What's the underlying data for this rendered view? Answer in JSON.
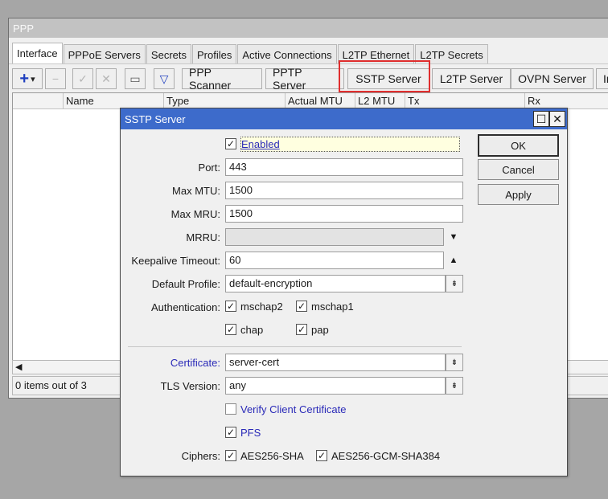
{
  "ppp": {
    "title": "PPP",
    "tabs": [
      "Interface",
      "PPPoE Servers",
      "Secrets",
      "Profiles",
      "Active Connections",
      "L2TP Ethernet",
      "L2TP Secrets"
    ],
    "toolbar": {
      "add_glyph": "+",
      "add_arrow": "▾",
      "remove_glyph": "−",
      "enable_glyph": "✓",
      "disable_glyph": "✕",
      "comment_glyph": "▭",
      "filter_glyph": "▽",
      "buttons": [
        "PPP Scanner",
        "PPTP Server",
        "SSTP Server",
        "L2TP Server",
        "OVPN Server",
        "In"
      ]
    },
    "columns": [
      "Name",
      "Type",
      "Actual MTU",
      "L2 MTU",
      "Tx",
      "Rx"
    ],
    "scroll_left": "◀",
    "status": "0 items out of 3"
  },
  "dlg": {
    "title": "SSTP Server",
    "maximize_glyph": "☐",
    "close_glyph": "✕",
    "enabled_label": "Enabled",
    "port_label": "Port:",
    "port": "443",
    "max_mtu_label": "Max MTU:",
    "max_mtu": "1500",
    "max_mru_label": "Max MRU:",
    "max_mru": "1500",
    "mrru_label": "MRRU:",
    "mrru": "",
    "keepalive_label": "Keepalive Timeout:",
    "keepalive": "60",
    "default_profile_label": "Default Profile:",
    "default_profile": "default-encryption",
    "auth_label": "Authentication:",
    "auth": [
      "mschap2",
      "mschap1",
      "chap",
      "pap"
    ],
    "certificate_label": "Certificate:",
    "certificate": "server-cert",
    "tls_label": "TLS Version:",
    "tls": "any",
    "verify_client_label": "Verify Client Certificate",
    "pfs_label": "PFS",
    "ciphers_label": "Ciphers:",
    "ciphers": [
      "AES256-SHA",
      "AES256-GCM-SHA384"
    ],
    "check_glyph": "✓",
    "down_glyph": "▼",
    "up_glyph": "▲",
    "dropdown_glyph": "⇟",
    "ok_label": "OK",
    "cancel_label": "Cancel",
    "apply_label": "Apply"
  },
  "colors": {
    "title_active": "#3d6bcb",
    "highlight": "#e02e2e",
    "link": "#2a2ab8"
  }
}
